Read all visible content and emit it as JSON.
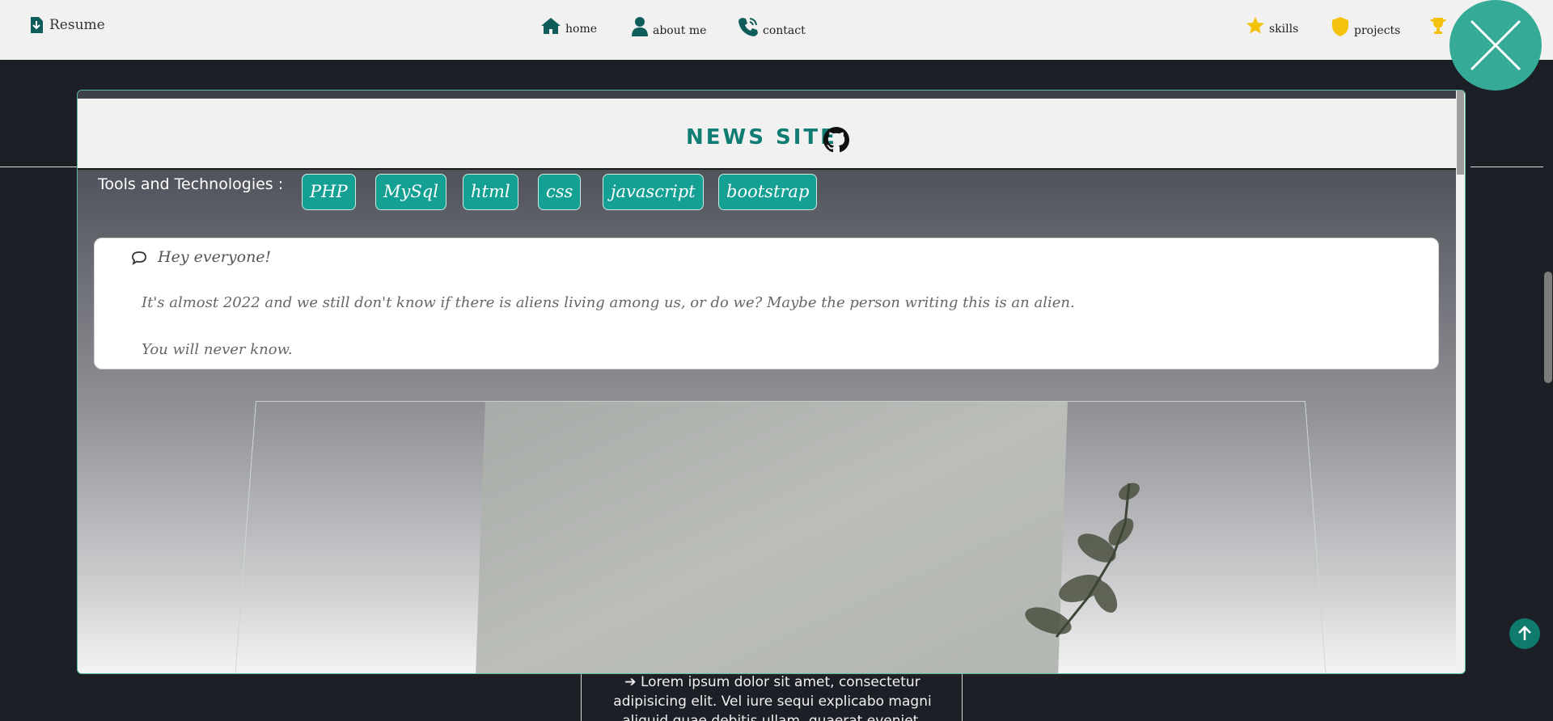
{
  "navbar": {
    "brand": "Resume",
    "links": {
      "home": "home",
      "about": "about me",
      "contact": "contact",
      "skills": "skills",
      "projects": "projects"
    },
    "icons": [
      "resume-icon",
      "home-icon",
      "user-icon",
      "phone-icon",
      "star-icon",
      "shield-icon",
      "trophy-icon"
    ]
  },
  "modal": {
    "title": "NEWS SITE",
    "tools_label": "Tools and Technologies :",
    "tools": [
      "PHP",
      "MySql",
      "html",
      "css",
      "javascript",
      "bootstrap"
    ],
    "message": {
      "greeting": "Hey everyone!",
      "line1": "It's almost 2022 and we still don't know if there is aliens living among us, or do we? Maybe the person writing this is an alien.",
      "line2": "You will never know."
    }
  },
  "background": {
    "text": "Lorem ipsum dolor sit amet, consectetur adipisicing elit. Vel iure sequi explicabo magni aliquid quae debitis ullam, quaerat eveniet, itaque in est."
  },
  "colors": {
    "accent": "#14a092",
    "title": "#0f7d73",
    "close": "#35ab97",
    "icons": "#0f5d5a",
    "gold": "#f4c20d"
  }
}
